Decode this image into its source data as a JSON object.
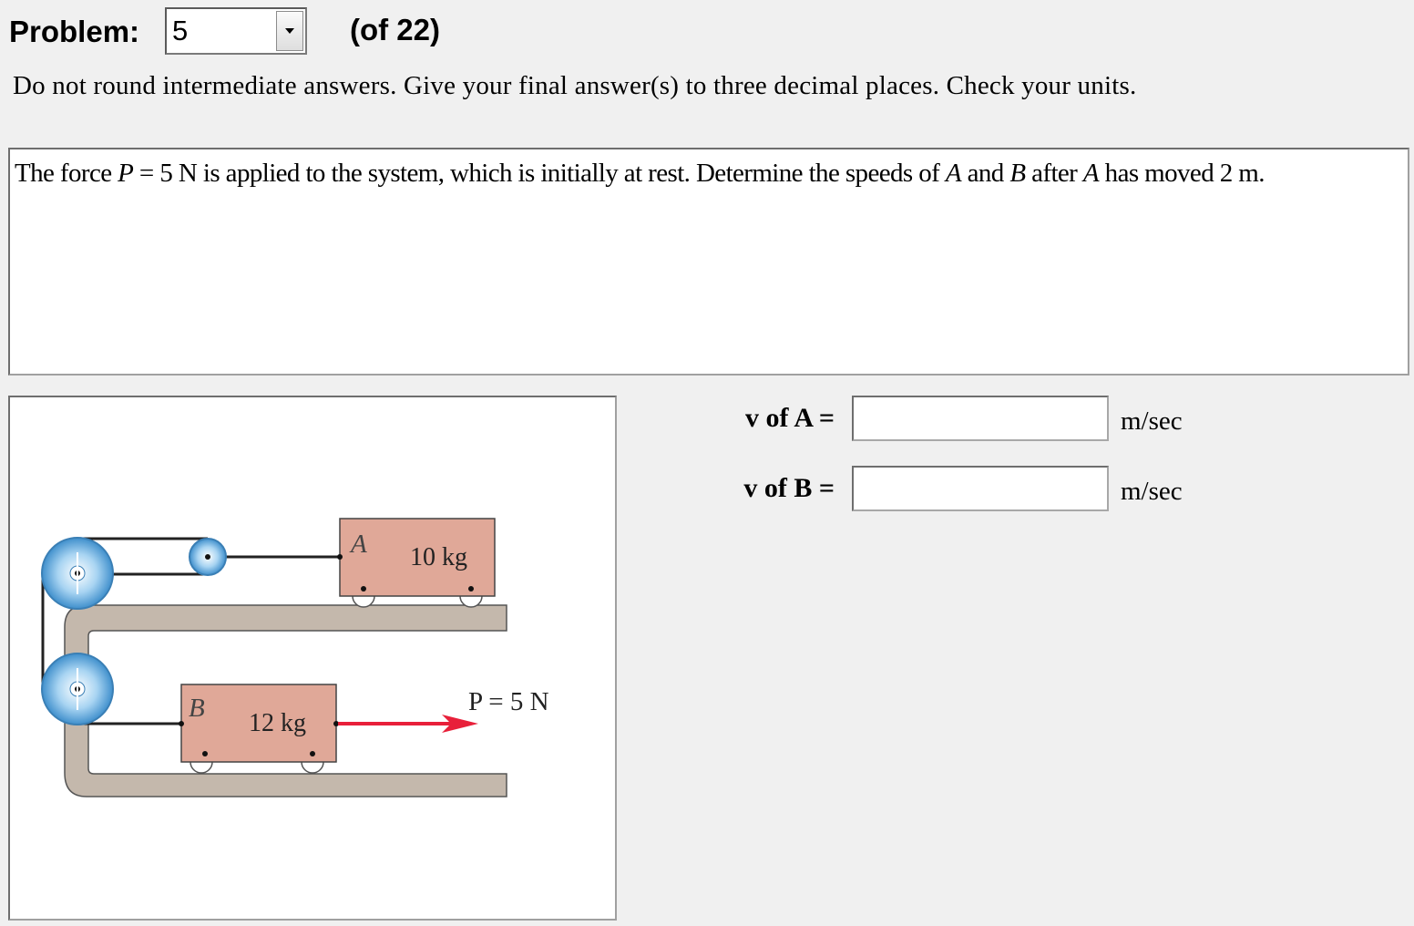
{
  "header": {
    "problem_label": "Problem:",
    "problem_value": "5",
    "of_text": "(of 22)"
  },
  "instructions": "Do not round intermediate answers.  Give your final answer(s) to three decimal places.  Check your units.",
  "question": {
    "seg1": "The force ",
    "var_p": "P",
    "seg2": " = 5 N is applied to the system, which is initially at rest. Determine the speeds of ",
    "var_a1": "A",
    "seg3": " and ",
    "var_b": "B",
    "seg4": " after ",
    "var_a2": "A",
    "seg5": " has moved 2 m."
  },
  "figure": {
    "block_a_letter": "A",
    "block_a_mass": "10 kg",
    "block_b_letter": "B",
    "block_b_mass": "12 kg",
    "force_label": "P = 5 N",
    "colors": {
      "block": "#e0a898",
      "track": "#c4b8ac",
      "pulley": "#6ab0e0",
      "force_arrow": "#e8203a"
    }
  },
  "answers": [
    {
      "label": "v of A =",
      "value": "",
      "unit": "m/sec"
    },
    {
      "label": "v of B =",
      "value": "",
      "unit": "m/sec"
    }
  ]
}
